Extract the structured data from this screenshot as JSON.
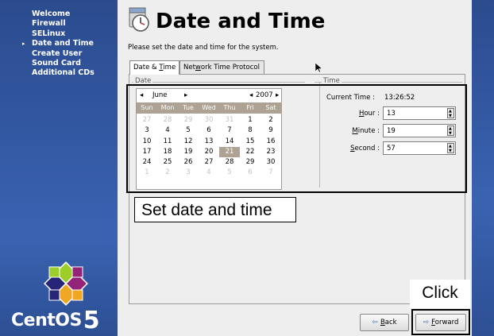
{
  "sidebar": {
    "steps": [
      {
        "label": "Welcome",
        "current": false
      },
      {
        "label": "Firewall",
        "current": false
      },
      {
        "label": "SELinux",
        "current": false
      },
      {
        "label": "Date and Time",
        "current": true
      },
      {
        "label": "Create User",
        "current": false
      },
      {
        "label": "Sound Card",
        "current": false
      },
      {
        "label": "Additional CDs",
        "current": false
      }
    ],
    "current_marker": "▸",
    "brand": "CentOS",
    "brand_version": "5"
  },
  "header": {
    "title": "Date and Time",
    "subtitle": "Please set the date and time for the system.",
    "icon": "clock-calendar-icon"
  },
  "tabs": [
    {
      "label": "Date & Time",
      "active": true
    },
    {
      "label": "Network Time Protocol",
      "active": false
    }
  ],
  "date_group": {
    "legend": "Date",
    "month": "June",
    "year": "2007",
    "weekdays": [
      "Sun",
      "Mon",
      "Tue",
      "Wed",
      "Thu",
      "Fri",
      "Sat"
    ],
    "weeks": [
      [
        {
          "d": "27",
          "o": true
        },
        {
          "d": "28",
          "o": true
        },
        {
          "d": "29",
          "o": true
        },
        {
          "d": "30",
          "o": true
        },
        {
          "d": "31",
          "o": true
        },
        {
          "d": "1"
        },
        {
          "d": "2"
        }
      ],
      [
        {
          "d": "3"
        },
        {
          "d": "4"
        },
        {
          "d": "5"
        },
        {
          "d": "6"
        },
        {
          "d": "7"
        },
        {
          "d": "8"
        },
        {
          "d": "9"
        }
      ],
      [
        {
          "d": "10"
        },
        {
          "d": "11"
        },
        {
          "d": "12"
        },
        {
          "d": "13"
        },
        {
          "d": "14"
        },
        {
          "d": "15"
        },
        {
          "d": "16"
        }
      ],
      [
        {
          "d": "17"
        },
        {
          "d": "18"
        },
        {
          "d": "19"
        },
        {
          "d": "20"
        },
        {
          "d": "21",
          "s": true
        },
        {
          "d": "22"
        },
        {
          "d": "23"
        }
      ],
      [
        {
          "d": "24"
        },
        {
          "d": "25"
        },
        {
          "d": "26"
        },
        {
          "d": "27"
        },
        {
          "d": "28"
        },
        {
          "d": "29"
        },
        {
          "d": "30"
        }
      ],
      [
        {
          "d": "1",
          "o": true
        },
        {
          "d": "2",
          "o": true
        },
        {
          "d": "3",
          "o": true
        },
        {
          "d": "4",
          "o": true
        },
        {
          "d": "5",
          "o": true
        },
        {
          "d": "6",
          "o": true
        },
        {
          "d": "7",
          "o": true
        }
      ]
    ]
  },
  "time_group": {
    "legend": "Time",
    "current_time_label": "Current Time :",
    "current_time_value": "13:26:52",
    "hour_label": "Hour :",
    "hour_value": "13",
    "minute_label": "Minute :",
    "minute_value": "19",
    "second_label": "Second :",
    "second_value": "57"
  },
  "annotations": {
    "set_date_text": "Set date and time",
    "click_text": "Click"
  },
  "footer": {
    "back_label": "Back",
    "forward_label": "Forward"
  },
  "colors": {
    "sidebar_blue": "#345aa5",
    "calendar_header": "#ada294"
  }
}
